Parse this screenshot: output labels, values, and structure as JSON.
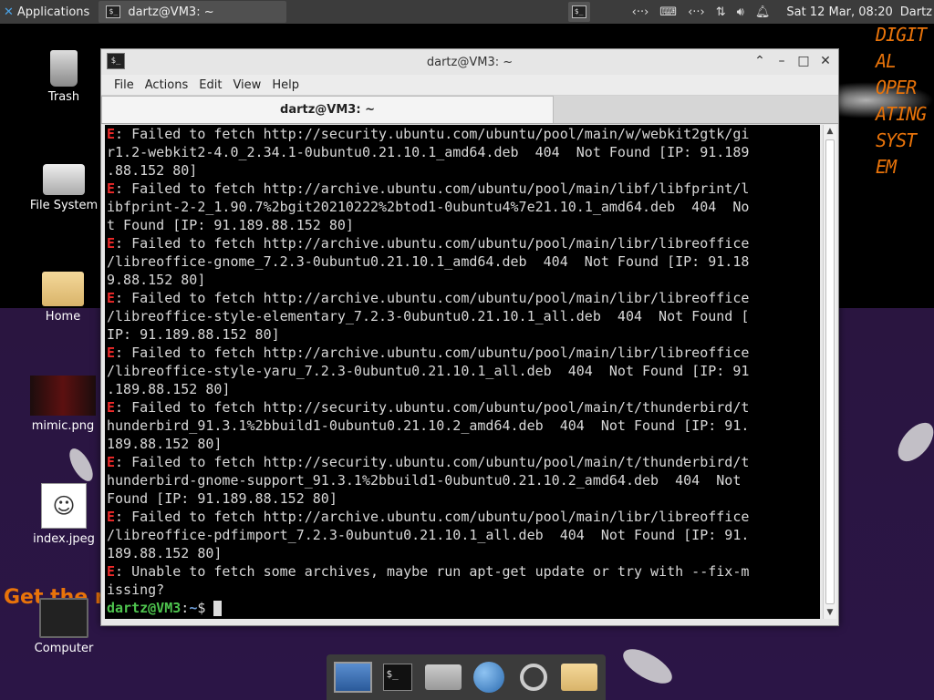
{
  "panel": {
    "app_menu_label": "Applications",
    "task_label": "dartz@VM3: ~",
    "clock": "Sat 12 Mar, 08:20",
    "user": "Dartz"
  },
  "desktop": {
    "icons": [
      {
        "label": "Trash"
      },
      {
        "label": "File System"
      },
      {
        "label": "Home"
      },
      {
        "label": "mimic.png"
      },
      {
        "label": "index.jpeg"
      },
      {
        "label": "Computer"
      }
    ],
    "wallpaper_text": "DIGIT\nAL\nOPER\nATING\nSYST\nEM",
    "wallpaper_text2": "Get the m"
  },
  "window": {
    "title": "dartz@VM3: ~",
    "menu": [
      "File",
      "Actions",
      "Edit",
      "View",
      "Help"
    ],
    "tab_label": "dartz@VM3: ~"
  },
  "terminal": {
    "lines": [
      {
        "err": "E",
        "text": ": Failed to fetch http://security.ubuntu.com/ubuntu/pool/main/w/webkit2gtk/gi"
      },
      {
        "err": "",
        "text": "r1.2-webkit2-4.0_2.34.1-0ubuntu0.21.10.1_amd64.deb  404  Not Found [IP: 91.189"
      },
      {
        "err": "",
        "text": ".88.152 80]"
      },
      {
        "err": "E",
        "text": ": Failed to fetch http://archive.ubuntu.com/ubuntu/pool/main/libf/libfprint/l"
      },
      {
        "err": "",
        "text": "ibfprint-2-2_1.90.7%2bgit20210222%2btod1-0ubuntu4%7e21.10.1_amd64.deb  404  No"
      },
      {
        "err": "",
        "text": "t Found [IP: 91.189.88.152 80]"
      },
      {
        "err": "E",
        "text": ": Failed to fetch http://archive.ubuntu.com/ubuntu/pool/main/libr/libreoffice"
      },
      {
        "err": "",
        "text": "/libreoffice-gnome_7.2.3-0ubuntu0.21.10.1_amd64.deb  404  Not Found [IP: 91.18"
      },
      {
        "err": "",
        "text": "9.88.152 80]"
      },
      {
        "err": "E",
        "text": ": Failed to fetch http://archive.ubuntu.com/ubuntu/pool/main/libr/libreoffice"
      },
      {
        "err": "",
        "text": "/libreoffice-style-elementary_7.2.3-0ubuntu0.21.10.1_all.deb  404  Not Found ["
      },
      {
        "err": "",
        "text": "IP: 91.189.88.152 80]"
      },
      {
        "err": "E",
        "text": ": Failed to fetch http://archive.ubuntu.com/ubuntu/pool/main/libr/libreoffice"
      },
      {
        "err": "",
        "text": "/libreoffice-style-yaru_7.2.3-0ubuntu0.21.10.1_all.deb  404  Not Found [IP: 91"
      },
      {
        "err": "",
        "text": ".189.88.152 80]"
      },
      {
        "err": "E",
        "text": ": Failed to fetch http://security.ubuntu.com/ubuntu/pool/main/t/thunderbird/t"
      },
      {
        "err": "",
        "text": "hunderbird_91.3.1%2bbuild1-0ubuntu0.21.10.2_amd64.deb  404  Not Found [IP: 91."
      },
      {
        "err": "",
        "text": "189.88.152 80]"
      },
      {
        "err": "E",
        "text": ": Failed to fetch http://security.ubuntu.com/ubuntu/pool/main/t/thunderbird/t"
      },
      {
        "err": "",
        "text": "hunderbird-gnome-support_91.3.1%2bbuild1-0ubuntu0.21.10.2_amd64.deb  404  Not"
      },
      {
        "err": "",
        "text": "Found [IP: 91.189.88.152 80]"
      },
      {
        "err": "E",
        "text": ": Failed to fetch http://archive.ubuntu.com/ubuntu/pool/main/libr/libreoffice"
      },
      {
        "err": "",
        "text": "/libreoffice-pdfimport_7.2.3-0ubuntu0.21.10.1_all.deb  404  Not Found [IP: 91."
      },
      {
        "err": "",
        "text": "189.88.152 80]"
      },
      {
        "err": "E",
        "text": ": Unable to fetch some archives, maybe run apt-get update or try with --fix-m"
      },
      {
        "err": "",
        "text": "issing?"
      }
    ],
    "prompt_user": "dartz@VM3",
    "prompt_sep": ":",
    "prompt_path": "~",
    "prompt_symbol": "$ "
  },
  "dock": {
    "items": [
      "screen-icon",
      "terminal-icon",
      "home-folder-icon",
      "web-browser-icon",
      "search-icon",
      "folder-icon"
    ]
  }
}
